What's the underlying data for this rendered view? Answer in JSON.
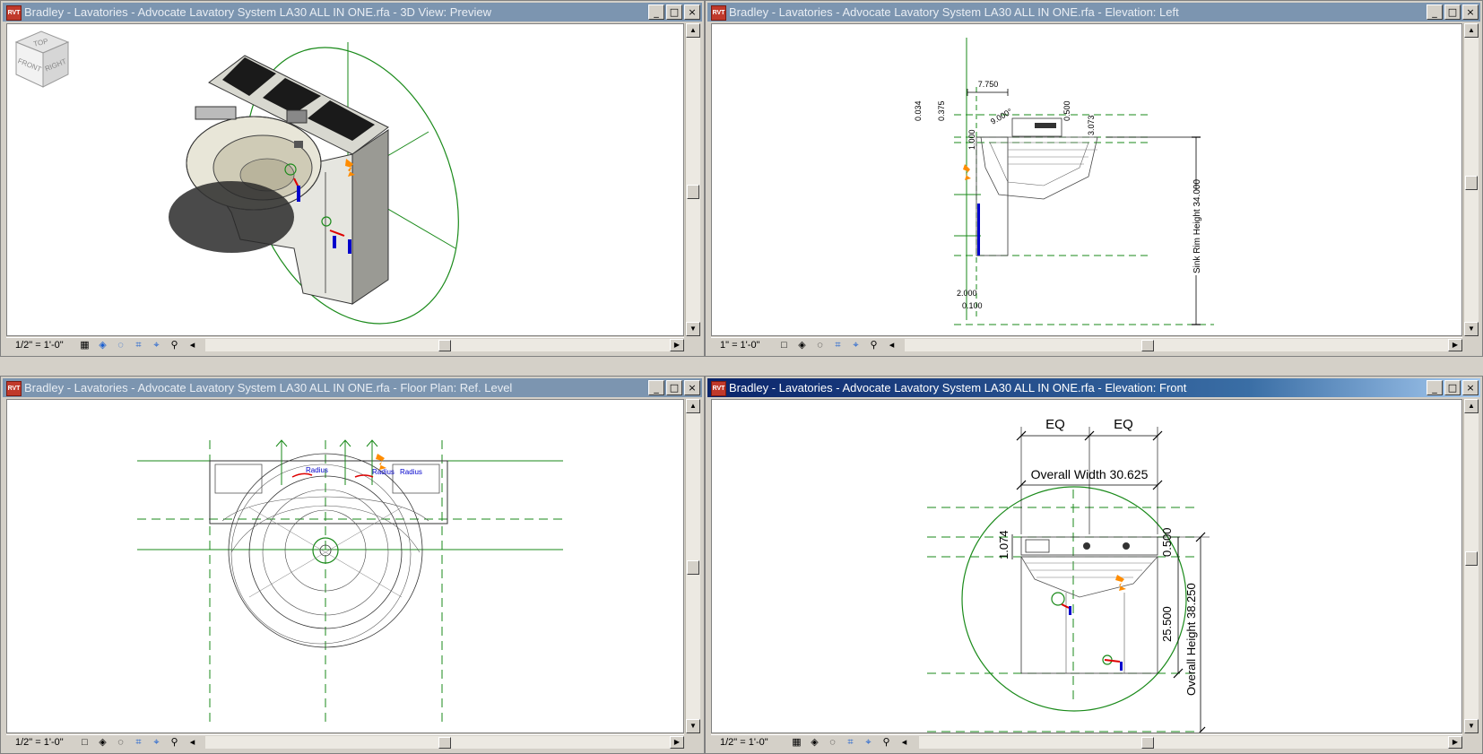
{
  "app_icon_label": "RVT",
  "windows": [
    {
      "id": "3d",
      "title": "Bradley - Lavatories - Advocate Lavatory System LA30 ALL IN ONE.rfa - 3D View: Preview",
      "scale": "1/2\" = 1'-0\"",
      "active": false
    },
    {
      "id": "left",
      "title": "Bradley - Lavatories - Advocate Lavatory System LA30 ALL IN ONE.rfa - Elevation: Left",
      "scale": "1\" = 1'-0\"",
      "active": false
    },
    {
      "id": "plan",
      "title": "Bradley - Lavatories - Advocate Lavatory System LA30 ALL IN ONE.rfa - Floor Plan: Ref. Level",
      "scale": "1/2\" = 1'-0\"",
      "active": false
    },
    {
      "id": "front",
      "title": "Bradley - Lavatories - Advocate Lavatory System LA30 ALL IN ONE.rfa - Elevation: Front",
      "scale": "1/2\" = 1'-0\"",
      "active": true
    }
  ],
  "window_buttons": {
    "minimize": "_",
    "restore": "□",
    "close": "×"
  },
  "navcube": {
    "top": "TOP",
    "front": "FRONT",
    "right": "RIGHT"
  },
  "left_view": {
    "dim_7750": "7.750",
    "dim_0034": "0.034",
    "dim_0375": "0.375",
    "dim_9000": "9.000°",
    "dim_0500": "0.500",
    "dim_3073": "3.073",
    "dim_1000": "1.000",
    "dim_2000": "2.000",
    "dim_0100": "0.100",
    "sink_rim": "Sink Rim Height 34.000"
  },
  "plan_view": {
    "radius_1": "Radius",
    "radius_2": "Radius",
    "radius_3": "Radius"
  },
  "front_view": {
    "eq1": "EQ",
    "eq2": "EQ",
    "overall_width": "Overall Width 30.625",
    "dim_1074": "1.074",
    "dim_0500": "0.500",
    "dim_25500": "25.500",
    "overall_height": "Overall Height 38.250"
  },
  "colors": {
    "ref_green": "#1a8a1a",
    "title_active": "#0a246a",
    "title_inactive": "#7c95b0",
    "control_orange": "#ff8c00",
    "dim_blue": "#0000cc"
  }
}
